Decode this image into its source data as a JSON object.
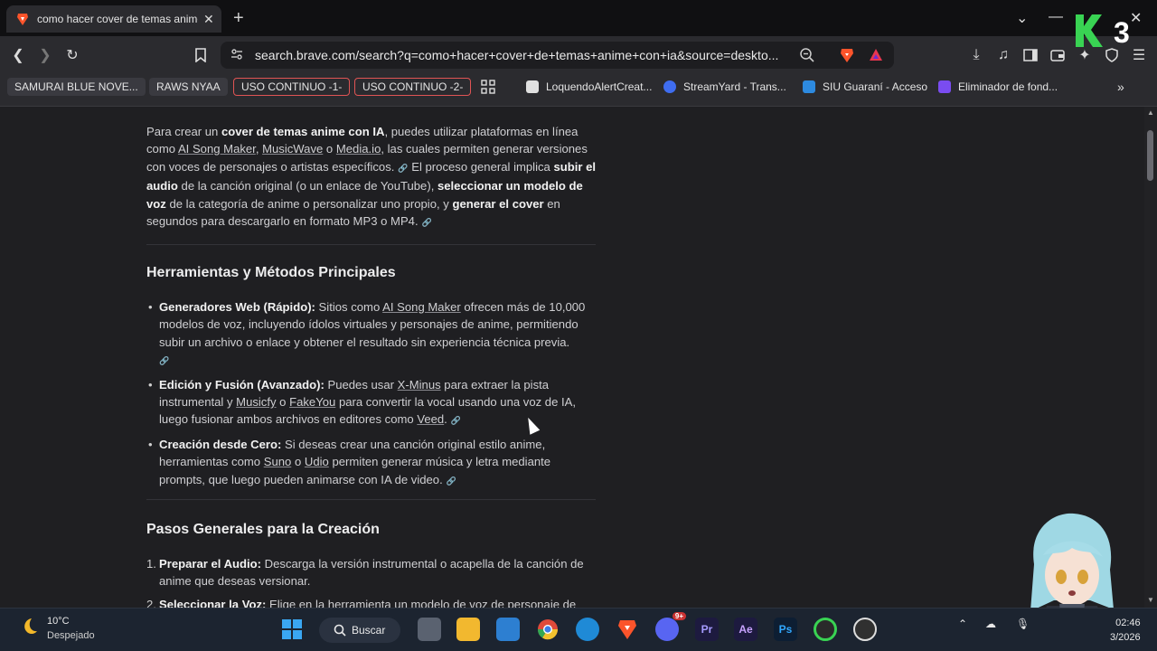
{
  "browser": {
    "tab_title": "como hacer cover de temas anime con ia - Brave Search",
    "url": "search.brave.com/search?q=como+hacer+cover+de+temas+anime+con+ia&source=deskto..."
  },
  "bookmarks": [
    {
      "label": "SAMURAI BLUE NOVE...",
      "style": "chip"
    },
    {
      "label": "RAWS NYAA",
      "style": "chip"
    },
    {
      "label": "USO CONTINUO -1-",
      "style": "red"
    },
    {
      "label": "USO CONTINUO -2-",
      "style": "red"
    },
    {
      "label": "LoquendoAlertCreat...",
      "style": "plain"
    },
    {
      "label": "StreamYard - Trans...",
      "style": "plain"
    },
    {
      "label": "SIU Guaraní - Acceso",
      "style": "plain"
    },
    {
      "label": "Eliminador de fond...",
      "style": "plain"
    }
  ],
  "article": {
    "intro": {
      "p1": "Para crear un ",
      "b1": "cover de temas anime con IA",
      "p2": ", puedes utilizar plataformas en línea como ",
      "l1": "AI Song Maker",
      "p3": ", ",
      "l2": "MusicWave",
      "p4": " o ",
      "l3": "Media.io",
      "p5": ", las cuales permiten generar versiones con voces de personajes o artistas específicos.",
      "p6": " El proceso general implica ",
      "b2": "subir el audio",
      "p7": " de la canción original (o un enlace de YouTube), ",
      "b3": "seleccionar un modelo de voz",
      "p8": " de la categoría de anime o personalizar uno propio, y ",
      "b4": "generar el cover",
      "p9": " en segundos para descargarlo en formato MP3 o MP4."
    },
    "h2_tools": "Herramientas y Métodos Principales",
    "tools": [
      {
        "title": "Generadores Web (Rápido):",
        "a": " Sitios como ",
        "link1": "AI Song Maker",
        "b": " ofrecen más de 10,000 modelos de voz, incluyendo ídolos virtuales y personajes de anime, permitiendo subir un archivo o enlace y obtener el resultado sin experiencia técnica previa."
      },
      {
        "title": "Edición y Fusión (Avanzado):",
        "a": " Puedes usar ",
        "link1": "X-Minus",
        "b": " para extraer la pista instrumental y ",
        "link2": "Musicfy",
        "c": " o ",
        "link3": "FakeYou",
        "d": " para convertir la vocal usando una voz de IA, luego fusionar ambos archivos en editores como ",
        "link4": "Veed",
        "e": "."
      },
      {
        "title": "Creación desde Cero:",
        "a": " Si deseas crear una canción original estilo anime, herramientas como ",
        "link1": "Suno",
        "b": " o ",
        "link2": "Udio",
        "c": " permiten generar música y letra mediante prompts, que luego pueden animarse con IA de video."
      }
    ],
    "h2_steps": "Pasos Generales para la Creación",
    "steps": [
      {
        "n": "1.",
        "title": "Preparar el Audio:",
        "text": " Descarga la versión instrumental o acapella de la canción de anime que deseas versionar."
      },
      {
        "n": "2.",
        "title": "Seleccionar la Voz:",
        "text": " Elige en la herramienta un modelo de voz de personaje de"
      }
    ]
  },
  "overlay": {
    "logo_text": "3"
  },
  "taskbar": {
    "temp": "10°C",
    "weather": "Despejado",
    "search": "Buscar",
    "apps": [
      "Pr",
      "Ae",
      "Ps"
    ],
    "notif_badge": "9+",
    "time": "02:46",
    "date": "3/2026"
  },
  "colors": {
    "accent_red": "#e05454",
    "brave_orange": "#fb542b",
    "link_k_green": "#39d353"
  }
}
